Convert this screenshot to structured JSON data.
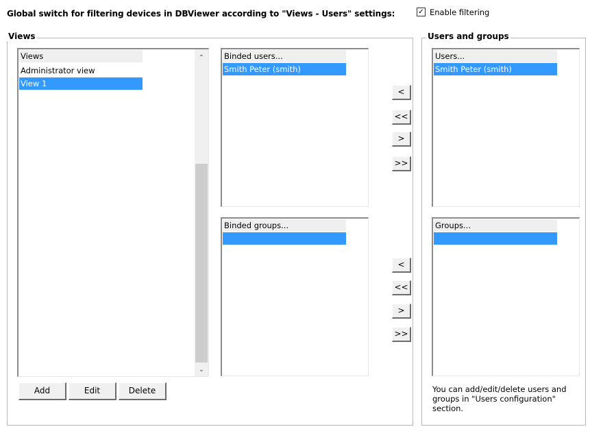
{
  "header": {
    "global_label": "Global switch for filtering devices in DBViewer according to \"Views - Users\" settings:",
    "enable_checked": "✓",
    "enable_label": "Enable filtering"
  },
  "views_group": {
    "title": "Views",
    "list_header": "Views",
    "items": [
      {
        "label": "Administrator view",
        "selected": false
      },
      {
        "label": "View 1",
        "selected": true
      }
    ],
    "buttons": {
      "add": "Add",
      "edit": "Edit",
      "delete": "Delete"
    }
  },
  "binded_users": {
    "header": "Binded users...",
    "items": [
      {
        "label": "Smith Peter (smith)",
        "selected": true
      }
    ]
  },
  "binded_groups": {
    "header": "Binded groups...",
    "items": [
      {
        "label": "",
        "selected": true
      }
    ]
  },
  "transfer_buttons": {
    "users": [
      "<",
      "<<",
      ">",
      ">>"
    ],
    "groups": [
      "<",
      "<<",
      ">",
      ">>"
    ]
  },
  "users_groups": {
    "title": "Users and groups",
    "users_header": "Users...",
    "users_items": [
      {
        "label": "Smith Peter (smith)",
        "selected": true
      }
    ],
    "groups_header": "Groups...",
    "groups_items": [
      {
        "label": "",
        "selected": true
      }
    ],
    "info_text": "You can add/edit/delete users and groups in \"Users configuration\" section."
  },
  "colors": {
    "selection": "#3399ff",
    "header_bg": "#efefef"
  },
  "icons": {
    "scroll_up": "chevron-up-icon",
    "scroll_down": "chevron-down-icon",
    "checkbox": "checkmark-icon"
  }
}
